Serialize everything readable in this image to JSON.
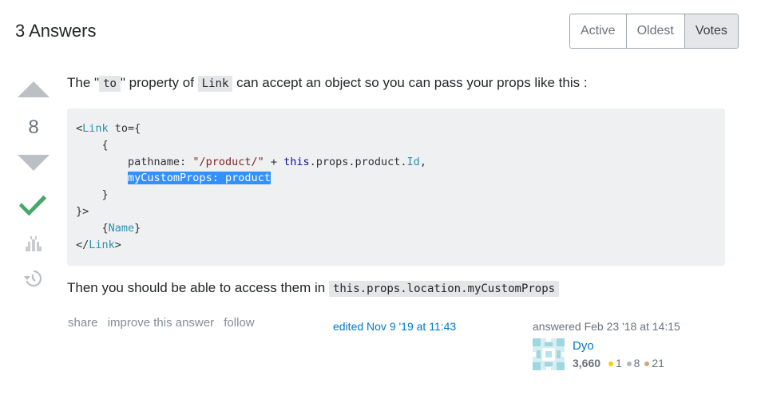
{
  "header": {
    "title": "3 Answers"
  },
  "sort_tabs": [
    "Active",
    "Oldest",
    "Votes"
  ],
  "vote": {
    "count": "8"
  },
  "body": {
    "p1_a": "The \"",
    "p1_code1": "to",
    "p1_b": "\" property of",
    "p1_code2": "Link",
    "p1_c": "can accept an object so you can pass your props like this :",
    "p2_a": "Then you should be able to access them in",
    "p2_code": "this.props.location.myCustomProps"
  },
  "code_block": {
    "l1_open": "<",
    "l1_tag": "Link",
    "l1_rest": " to={",
    "l2": "    {",
    "l3_key": "        pathname: ",
    "l3_str": "\"/product/\"",
    "l3_plus": " + ",
    "l3_this": "this",
    "l3_mid": ".props.product.",
    "l3_id": "Id",
    "l3_end": ",",
    "l4_indent": "        ",
    "l4_sel": "myCustomProps: product",
    "l5": "    }",
    "l6": "}>",
    "l7_indent": "    {",
    "l7_name": "Name",
    "l7_close": "}",
    "l8_open": "</",
    "l8_tag": "Link",
    "l8_close": ">"
  },
  "post_menu": {
    "share": "share",
    "improve": "improve this answer",
    "follow": "follow"
  },
  "edited": {
    "text": "edited Nov 9 '19 at 11:43"
  },
  "user": {
    "answered": "answered Feb 23 '18 at 14:15",
    "name": "Dyo",
    "reputation": "3,660",
    "gold": "1",
    "silver": "8",
    "bronze": "21"
  },
  "colors": {
    "gold": "#ffcc01",
    "silver": "#b4b8bc",
    "bronze": "#d1a684",
    "accepted": "#48a868",
    "link": "#0077cc"
  }
}
